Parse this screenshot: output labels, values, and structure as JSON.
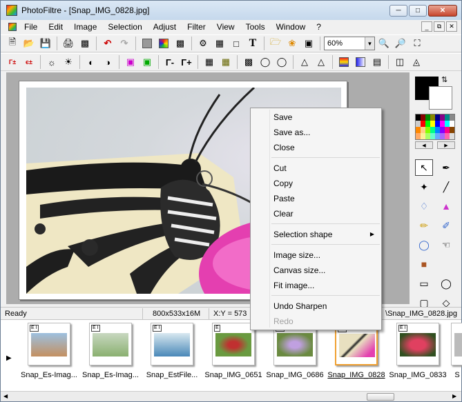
{
  "window": {
    "title": "PhotoFiltre - [Snap_IMG_0828.jpg]"
  },
  "menubar": {
    "items": [
      "File",
      "Edit",
      "Image",
      "Selection",
      "Adjust",
      "Filter",
      "View",
      "Tools",
      "Window",
      "?"
    ]
  },
  "toolbar": {
    "zoom_value": "60%"
  },
  "status": {
    "ready": "Ready",
    "dimensions": "800x533x16M",
    "coords": "X:Y = 573",
    "filename": "\\Snap_IMG_0828.jpg"
  },
  "context_menu": {
    "group1": [
      "Save",
      "Save as...",
      "Close"
    ],
    "group2": [
      "Cut",
      "Copy",
      "Paste",
      "Clear"
    ],
    "group3": [
      "Selection shape"
    ],
    "group4": [
      "Image size...",
      "Canvas size...",
      "Fit image..."
    ],
    "group5": [
      "Undo Sharpen",
      "Redo"
    ]
  },
  "thumbnails": [
    {
      "label": "Snap_Es-Imag...",
      "badge": "E I",
      "color": "#7aa0c0"
    },
    {
      "label": "Snap_Es-Imag...",
      "badge": "E I",
      "color": "#8ab070"
    },
    {
      "label": "Snap_EstFile...",
      "badge": "E I",
      "color": "#4a88b8"
    },
    {
      "label": "Snap_IMG_0651",
      "badge": "E",
      "color": "#6a9a40"
    },
    {
      "label": "Snap_IMG_0686",
      "badge": "E I",
      "color": "#9a7ab8"
    },
    {
      "label": "Snap_IMG_0828",
      "badge": "E I",
      "color": "#d8d4c8"
    },
    {
      "label": "Snap_IMG_0833",
      "badge": "E I",
      "color": "#c03048"
    },
    {
      "label": "S",
      "badge": "",
      "color": "#bbbbbb"
    }
  ],
  "colors": {
    "foreground": "#000000",
    "background": "#ffffff"
  }
}
